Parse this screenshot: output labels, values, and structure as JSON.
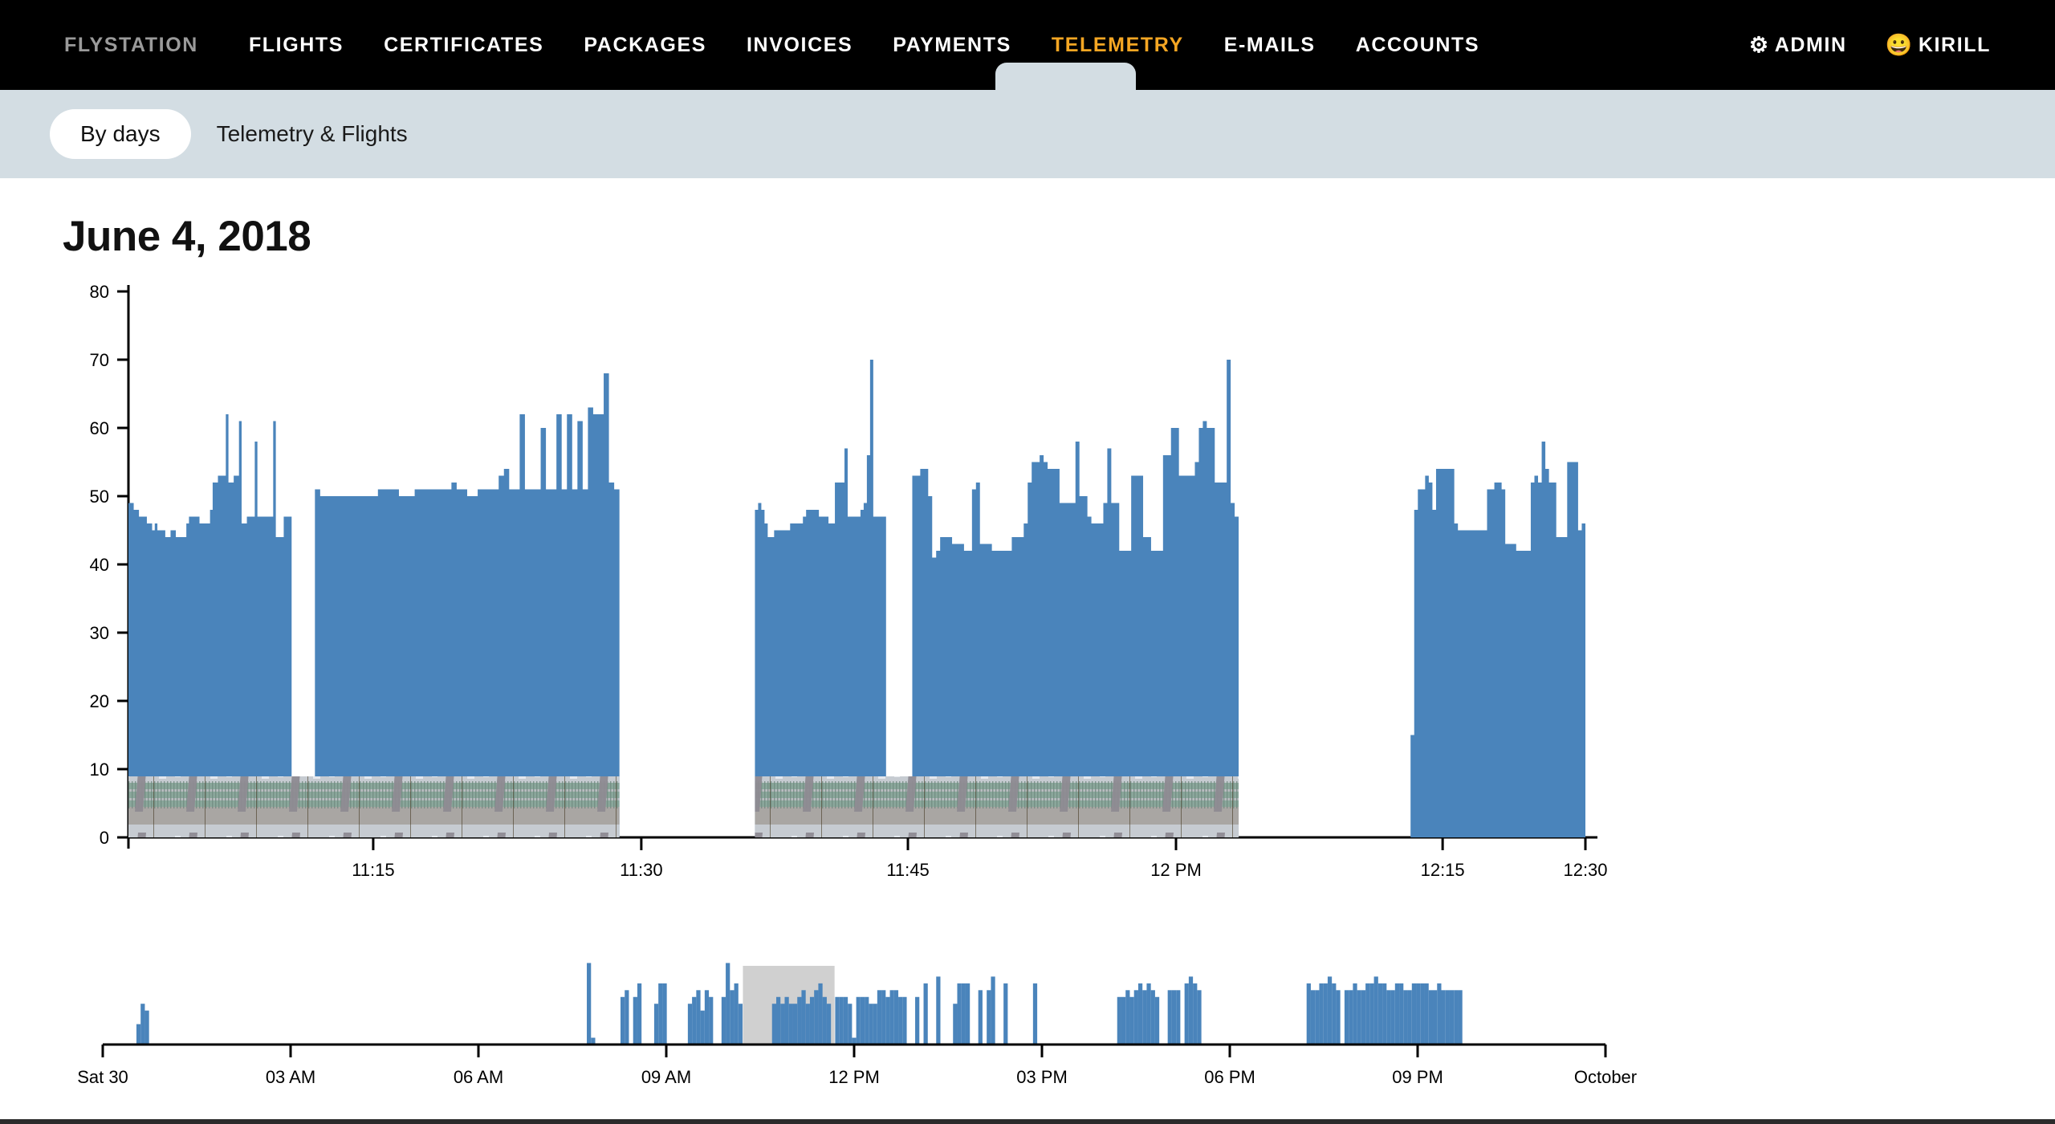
{
  "topnav": {
    "brand": "FLYSTATION",
    "items": [
      {
        "label": "FLIGHTS",
        "active": false
      },
      {
        "label": "CERTIFICATES",
        "active": false
      },
      {
        "label": "PACKAGES",
        "active": false
      },
      {
        "label": "INVOICES",
        "active": false
      },
      {
        "label": "PAYMENTS",
        "active": false
      },
      {
        "label": "TELEMETRY",
        "active": true
      },
      {
        "label": "E-MAILS",
        "active": false
      },
      {
        "label": "ACCOUNTS",
        "active": false
      }
    ],
    "admin_label": "ADMIN",
    "admin_icon": "gear-icon",
    "user_label": "KIRILL",
    "user_icon": "smiley-face-icon",
    "active_color": "#f5a623",
    "brand_color": "#9a9a9a",
    "background": "#000000"
  },
  "subnav": {
    "pill_label": "By days",
    "link_label": "Telemetry & Flights",
    "background": "#d3dde3"
  },
  "page": {
    "title": "June 4, 2018"
  },
  "chart_data": {
    "type": "area",
    "title": "June 4, 2018",
    "xlabel": "",
    "ylabel": "",
    "ylim": [
      0,
      80
    ],
    "yticks": [
      0,
      10,
      20,
      30,
      40,
      50,
      60,
      70,
      80
    ],
    "xticks": [
      "11:15",
      "11:30",
      "11:45",
      "12 PM",
      "12:15",
      "12:30"
    ],
    "xtick_positions": [
      0.168,
      0.352,
      0.535,
      0.719,
      0.902,
      1.0
    ],
    "grid": false,
    "legend": null,
    "series_color": "#4a84bb",
    "filmstrip": {
      "present": true,
      "description": "thumbnail filmstrip of wind tunnel interior photos rendered along the baseline",
      "segments": [
        {
          "x_start": 0.0,
          "x_end": 0.337
        },
        {
          "x_start": 0.43,
          "x_end": 0.762
        }
      ]
    },
    "segments": [
      {
        "x_start": 0.0,
        "x_end": 0.112,
        "values": [
          49,
          49,
          48,
          48,
          47,
          47,
          47,
          46,
          46,
          45,
          46,
          45,
          45,
          45,
          44,
          44,
          45,
          45,
          44,
          44,
          44,
          44,
          46,
          47,
          47,
          47,
          47,
          46,
          46,
          46,
          46,
          48,
          52,
          52,
          53,
          53,
          53,
          62,
          52,
          52,
          53,
          53,
          61,
          46,
          46,
          47,
          47,
          47,
          58,
          47,
          47,
          47,
          47,
          47,
          47,
          61,
          44,
          44,
          44,
          47,
          47,
          47
        ]
      },
      {
        "x_start": 0.128,
        "x_end": 0.337,
        "values": [
          51,
          50,
          50,
          50,
          50,
          50,
          50,
          50,
          50,
          50,
          50,
          50,
          51,
          51,
          51,
          51,
          50,
          50,
          50,
          51,
          51,
          51,
          51,
          51,
          51,
          51,
          52,
          51,
          51,
          50,
          50,
          51,
          51,
          51,
          51,
          53,
          54,
          51,
          51,
          62,
          51,
          51,
          51,
          60,
          51,
          51,
          62,
          51,
          62,
          51,
          61,
          51,
          63,
          62,
          62,
          68,
          52,
          51
        ]
      },
      {
        "x_start": 0.43,
        "x_end": 0.52,
        "values": [
          48,
          49,
          48,
          46,
          44,
          44,
          45,
          45,
          45,
          45,
          45,
          46,
          46,
          46,
          46,
          47,
          48,
          48,
          48,
          48,
          47,
          47,
          47,
          46,
          46,
          52,
          52,
          52,
          57,
          47,
          47,
          47,
          47,
          48,
          49,
          56,
          70,
          47,
          47,
          47,
          47
        ]
      },
      {
        "x_start": 0.538,
        "x_end": 0.762,
        "values": [
          53,
          53,
          54,
          54,
          50,
          41,
          42,
          44,
          44,
          44,
          43,
          43,
          43,
          42,
          42,
          51,
          52,
          43,
          43,
          43,
          42,
          42,
          42,
          42,
          42,
          44,
          44,
          44,
          46,
          52,
          55,
          55,
          56,
          55,
          54,
          54,
          54,
          49,
          49,
          49,
          49,
          58,
          50,
          50,
          47,
          46,
          46,
          46,
          49,
          57,
          49,
          49,
          42,
          42,
          42,
          53,
          53,
          53,
          44,
          44,
          42,
          42,
          42,
          56,
          56,
          60,
          60,
          53,
          53,
          53,
          53,
          55,
          60,
          61,
          60,
          60,
          52,
          52,
          52,
          70,
          49,
          47
        ]
      },
      {
        "x_start": 0.88,
        "x_end": 1.0,
        "values": [
          15,
          48,
          51,
          51,
          53,
          52,
          48,
          54,
          54,
          54,
          54,
          54,
          46,
          45,
          45,
          45,
          45,
          45,
          45,
          45,
          45,
          51,
          51,
          52,
          52,
          51,
          43,
          43,
          43,
          42,
          42,
          42,
          42,
          52,
          53,
          52,
          58,
          54,
          52,
          52,
          44,
          44,
          44,
          55,
          55,
          55,
          45,
          46
        ]
      }
    ]
  },
  "brush_chart": {
    "type": "area",
    "xticks": [
      "Sat 30",
      "03 AM",
      "06 AM",
      "09 AM",
      "12 PM",
      "03 PM",
      "06 PM",
      "09 PM",
      "October"
    ],
    "series_color": "#4a84bb",
    "selection": {
      "x_start": 0.426,
      "x_end": 0.487,
      "fill": "#d0d0d0"
    },
    "values": [
      0,
      0,
      0,
      0,
      0,
      0,
      0,
      0,
      3,
      6,
      5,
      0,
      0,
      0,
      0,
      0,
      0,
      0,
      0,
      0,
      0,
      0,
      0,
      0,
      0,
      0,
      0,
      0,
      0,
      0,
      0,
      0,
      0,
      0,
      0,
      0,
      0,
      0,
      0,
      0,
      0,
      0,
      0,
      0,
      0,
      0,
      0,
      0,
      0,
      0,
      0,
      0,
      0,
      0,
      0,
      0,
      0,
      0,
      0,
      0,
      0,
      0,
      0,
      0,
      0,
      0,
      0,
      0,
      0,
      0,
      0,
      0,
      0,
      0,
      0,
      0,
      0,
      0,
      0,
      0,
      0,
      0,
      0,
      0,
      0,
      0,
      0,
      0,
      0,
      0,
      0,
      0,
      0,
      0,
      0,
      0,
      0,
      0,
      0,
      0,
      0,
      0,
      0,
      0,
      0,
      0,
      0,
      0,
      0,
      0,
      0,
      0,
      0,
      0,
      0,
      12,
      1,
      0,
      0,
      0,
      0,
      0,
      0,
      7,
      8,
      0,
      7,
      9,
      0,
      0,
      0,
      6,
      9,
      9,
      0,
      0,
      0,
      0,
      0,
      6,
      7,
      8,
      5,
      8,
      7,
      0,
      0,
      7,
      12,
      8,
      9,
      6,
      0,
      0,
      0,
      0,
      0,
      0,
      0,
      6,
      7,
      6,
      7,
      6,
      6,
      7,
      8,
      6,
      7,
      8,
      9,
      7,
      6,
      0,
      7,
      7,
      7,
      6,
      1,
      7,
      7,
      7,
      6,
      6,
      8,
      8,
      7,
      8,
      8,
      7,
      7,
      0,
      0,
      7,
      0,
      9,
      0,
      0,
      10,
      0,
      0,
      0,
      6,
      9,
      9,
      9,
      0,
      0,
      8,
      0,
      8,
      10,
      0,
      0,
      9,
      0,
      0,
      0,
      0,
      0,
      0,
      9,
      0,
      0,
      0,
      0,
      0,
      0,
      0,
      0,
      0,
      0,
      0,
      0,
      0,
      0,
      0,
      0,
      0,
      0,
      0,
      7,
      7,
      8,
      7,
      8,
      9,
      8,
      9,
      8,
      7,
      0,
      0,
      8,
      8,
      8,
      0,
      9,
      10,
      9,
      8,
      0,
      0,
      0,
      0,
      0,
      0,
      0,
      0,
      0,
      0,
      0,
      0,
      0,
      0,
      0,
      0,
      0,
      0,
      0,
      0,
      0,
      0,
      0,
      0,
      0,
      9,
      8,
      8,
      9,
      9,
      10,
      9,
      8,
      0,
      8,
      8,
      9,
      8,
      8,
      9,
      9,
      10,
      9,
      9,
      8,
      8,
      9,
      9,
      8,
      8,
      9,
      9,
      9,
      9,
      8,
      8,
      9,
      8,
      8,
      8,
      8,
      8,
      0,
      0,
      0,
      0,
      0,
      0,
      0,
      0,
      0,
      0,
      0,
      0,
      0,
      0,
      0,
      0,
      0,
      0,
      0,
      0,
      0,
      0,
      0,
      0,
      0,
      0,
      0,
      0,
      0,
      0,
      0,
      0,
      0,
      0
    ]
  }
}
